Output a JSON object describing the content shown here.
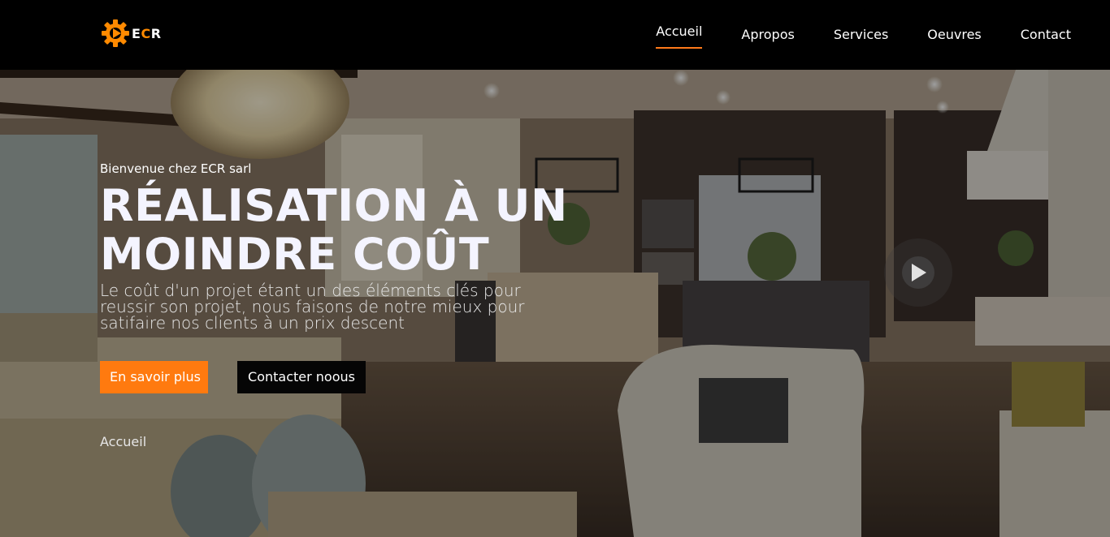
{
  "brand": {
    "letter_e": "E",
    "letter_c": "C",
    "letter_r": "R",
    "logo_icon": "gear-play-icon",
    "accent": "#ff7a0f"
  },
  "nav": {
    "items": [
      {
        "label": "Accueil",
        "active": true
      },
      {
        "label": "Apropos"
      },
      {
        "label": "Services"
      },
      {
        "label": "Oeuvres"
      },
      {
        "label": "Contact"
      }
    ]
  },
  "hero": {
    "welcome": "Bienvenue chez ECR sarl",
    "title": "RÉALISATION À UN MOINDRE COÛT",
    "subtitle": "Le coût d'un projet étant un des éléments clés pour reussir son projet, nous faisons de notre mieux pour satifaire nos clients à un prix descent",
    "primary_button": "En savoir plus",
    "secondary_button": "Contacter noous",
    "breadcrumb": "Accueil",
    "play_icon": "play-icon"
  }
}
